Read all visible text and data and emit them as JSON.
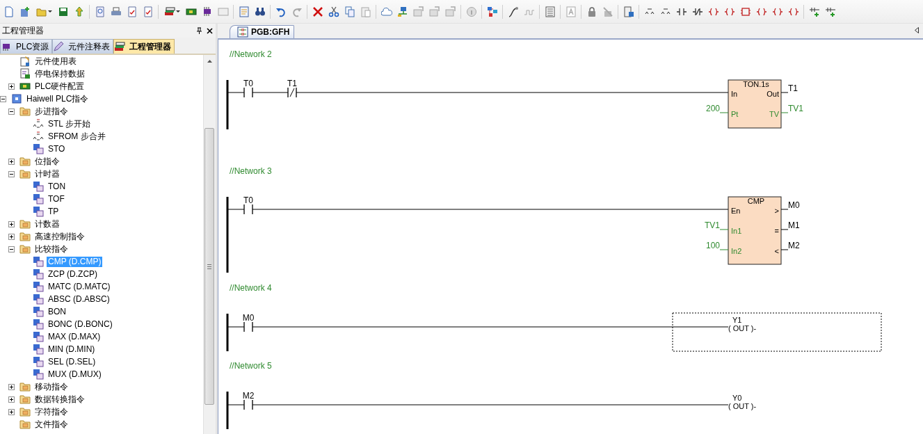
{
  "toolbar": [
    {
      "kind": "new",
      "disabled": false
    },
    {
      "kind": "add-project",
      "disabled": false
    },
    {
      "kind": "open",
      "disabled": false,
      "dropdown": true
    },
    {
      "kind": "save",
      "disabled": false
    },
    {
      "kind": "upload",
      "disabled": false
    },
    {
      "kind": "separator"
    },
    {
      "kind": "preview",
      "disabled": false
    },
    {
      "kind": "print",
      "disabled": false
    },
    {
      "kind": "check",
      "disabled": false
    },
    {
      "kind": "check",
      "disabled": false
    },
    {
      "kind": "separator"
    },
    {
      "kind": "stack",
      "disabled": false,
      "dropdown": true
    },
    {
      "kind": "board",
      "disabled": false
    },
    {
      "kind": "chip",
      "disabled": false
    },
    {
      "kind": "monitor",
      "disabled": true
    },
    {
      "kind": "separator"
    },
    {
      "kind": "checklist",
      "disabled": false
    },
    {
      "kind": "find",
      "disabled": false
    },
    {
      "kind": "separator"
    },
    {
      "kind": "undo",
      "disabled": false
    },
    {
      "kind": "redo",
      "disabled": true
    },
    {
      "kind": "separator"
    },
    {
      "kind": "delete",
      "disabled": false
    },
    {
      "kind": "cut",
      "disabled": false
    },
    {
      "kind": "copy",
      "disabled": false
    },
    {
      "kind": "paste",
      "disabled": true
    },
    {
      "kind": "separator"
    },
    {
      "kind": "cloud",
      "disabled": false
    },
    {
      "kind": "network",
      "disabled": false
    },
    {
      "kind": "transfer",
      "disabled": true
    },
    {
      "kind": "transfer",
      "disabled": true
    },
    {
      "kind": "transfer",
      "disabled": true
    },
    {
      "kind": "separator"
    },
    {
      "kind": "info",
      "disabled": true
    },
    {
      "kind": "separator"
    },
    {
      "kind": "diagram",
      "disabled": false
    },
    {
      "kind": "separator"
    },
    {
      "kind": "probe",
      "disabled": false
    },
    {
      "kind": "pulse",
      "disabled": true
    },
    {
      "kind": "separator"
    },
    {
      "kind": "table",
      "disabled": false
    },
    {
      "kind": "separator"
    },
    {
      "kind": "font",
      "disabled": true
    },
    {
      "kind": "separator"
    },
    {
      "kind": "lock",
      "disabled": false
    },
    {
      "kind": "unlock",
      "disabled": true
    },
    {
      "kind": "separator"
    },
    {
      "kind": "device",
      "disabled": false
    },
    {
      "kind": "separator"
    },
    {
      "kind": "step",
      "disabled": false
    },
    {
      "kind": "step",
      "disabled": false
    },
    {
      "kind": "contact-no",
      "disabled": false
    },
    {
      "kind": "contact-nc",
      "disabled": false
    },
    {
      "kind": "coil",
      "disabled": false
    },
    {
      "kind": "coil",
      "disabled": false
    },
    {
      "kind": "block",
      "disabled": false
    },
    {
      "kind": "coil",
      "disabled": false
    },
    {
      "kind": "coil",
      "disabled": false
    },
    {
      "kind": "coil",
      "disabled": false
    },
    {
      "kind": "separator"
    },
    {
      "kind": "insert",
      "disabled": false
    },
    {
      "kind": "insert",
      "disabled": false
    }
  ],
  "left_panel": {
    "title": "工程管理器",
    "tabs": [
      {
        "label": "PLC资源",
        "kind": "chip",
        "selected": false
      },
      {
        "label": "元件注释表",
        "kind": "pencil",
        "selected": false
      },
      {
        "label": "工程管理器",
        "kind": "stack",
        "selected": true
      }
    ],
    "tree": [
      {
        "children": [
          {
            "label": "元件使用表",
            "kind": "table",
            "selected": false
          },
          {
            "label": "停电保持数据",
            "kind": "data",
            "selected": false
          },
          {
            "label": "PLC硬件配置",
            "kind": "board",
            "expanded": false,
            "selected": false
          }
        ]
      },
      {
        "label": "Haiwell PLC指令",
        "kind": "root",
        "expanded": true,
        "selected": false,
        "children": [
          {
            "label": "步进指令",
            "kind": "folder",
            "expanded": true,
            "selected": false,
            "children": [
              {
                "label": "STL 步开始",
                "kind": "step",
                "selected": false
              },
              {
                "label": "SFROM 步合并",
                "kind": "step",
                "selected": false
              },
              {
                "label": "STO",
                "kind": "instr",
                "selected": false
              }
            ]
          },
          {
            "label": "位指令",
            "kind": "folder",
            "expanded": false,
            "selected": false
          },
          {
            "label": "计时器",
            "kind": "folder",
            "expanded": true,
            "selected": false,
            "children": [
              {
                "label": "TON",
                "kind": "instr",
                "selected": false
              },
              {
                "label": "TOF",
                "kind": "instr",
                "selected": false
              },
              {
                "label": "TP",
                "kind": "instr",
                "selected": false
              }
            ]
          },
          {
            "label": "计数器",
            "kind": "folder",
            "expanded": false,
            "selected": false
          },
          {
            "label": "高速控制指令",
            "kind": "folder",
            "expanded": false,
            "selected": false
          },
          {
            "label": "比较指令",
            "kind": "folder",
            "expanded": true,
            "selected": false,
            "children": [
              {
                "label": "CMP (D.CMP)",
                "kind": "instr",
                "selected": true
              },
              {
                "label": "ZCP (D.ZCP)",
                "kind": "instr",
                "selected": false
              },
              {
                "label": "MATC (D.MATC)",
                "kind": "instr",
                "selected": false
              },
              {
                "label": "ABSC (D.ABSC)",
                "kind": "instr",
                "selected": false
              },
              {
                "label": "BON",
                "kind": "instr",
                "selected": false
              },
              {
                "label": "BONC (D.BONC)",
                "kind": "instr",
                "selected": false
              },
              {
                "label": "MAX (D.MAX)",
                "kind": "instr",
                "selected": false
              },
              {
                "label": "MIN (D.MIN)",
                "kind": "instr",
                "selected": false
              },
              {
                "label": "SEL (D.SEL)",
                "kind": "instr",
                "selected": false
              },
              {
                "label": "MUX (D.MUX)",
                "kind": "instr",
                "selected": false
              }
            ]
          },
          {
            "label": "移动指令",
            "kind": "folder",
            "expanded": false,
            "selected": false
          },
          {
            "label": "数据转换指令",
            "kind": "folder",
            "expanded": false,
            "selected": false
          },
          {
            "label": "字符指令",
            "kind": "folder",
            "expanded": false,
            "selected": false
          },
          {
            "label": "文件指令",
            "kind": "folder",
            "selected": false
          }
        ]
      }
    ]
  },
  "editor": {
    "tabs": [
      {
        "label": "PGB:GFH",
        "selected": true
      }
    ],
    "networks": [
      {
        "label": "//Network 2",
        "contacts": [
          {
            "operand": "T0",
            "kind": "no"
          },
          {
            "operand": "T1",
            "kind": "nc"
          }
        ],
        "output": {
          "kind": "block",
          "title": "TON.1s",
          "inputs": [
            {
              "pin": "In",
              "kind": "power"
            },
            {
              "pin": "Pt",
              "kind": "value",
              "operand": "200"
            }
          ],
          "outputs": [
            {
              "pin": "Out",
              "kind": "power",
              "operand": "T1"
            },
            {
              "pin": "TV",
              "kind": "value",
              "operand": "TV1"
            }
          ]
        }
      },
      {
        "label": "//Network 3",
        "contacts": [
          {
            "operand": "T0",
            "kind": "no"
          }
        ],
        "output": {
          "kind": "block",
          "title": "CMP",
          "inputs": [
            {
              "pin": "En",
              "kind": "power"
            },
            {
              "pin": "In1",
              "kind": "value",
              "operand": "TV1"
            },
            {
              "pin": "In2",
              "kind": "value",
              "operand": "100"
            }
          ],
          "outputs": [
            {
              "pin": ">",
              "kind": "power",
              "operand": "M0"
            },
            {
              "pin": "=",
              "kind": "power",
              "operand": "M1"
            },
            {
              "pin": "<",
              "kind": "power",
              "operand": "M2"
            }
          ]
        }
      },
      {
        "label": "//Network 4",
        "contacts": [
          {
            "operand": "M0",
            "kind": "no"
          }
        ],
        "output": {
          "kind": "coil",
          "operand": "Y1",
          "instruction": "( OUT )-",
          "selected": true
        }
      },
      {
        "label": "//Network 5",
        "contacts": [
          {
            "operand": "M2",
            "kind": "no"
          }
        ],
        "output": {
          "kind": "coil",
          "operand": "Y0",
          "instruction": "( OUT )-",
          "selected": false
        }
      }
    ]
  }
}
